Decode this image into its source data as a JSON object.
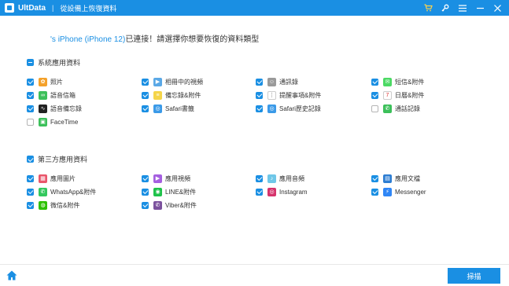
{
  "titlebar": {
    "app_name": "UltData",
    "separator": "|",
    "subtitle": "從設備上恢復資料",
    "icons": [
      "cart-icon",
      "key-icon",
      "menu-icon",
      "minimize-icon",
      "close-icon"
    ]
  },
  "heading": {
    "device": "'s iPhone (iPhone 12)",
    "text": "已連接！請選擇你想要恢復的資料類型"
  },
  "colors": {
    "accent": "#1a8fe3",
    "titlebar": "#1a8fe3"
  },
  "sections": [
    {
      "title": "系統應用資料",
      "state": "partial",
      "items": [
        {
          "label": "照片",
          "checked": true,
          "icon": "photos-icon",
          "color": "#f4a12a"
        },
        {
          "label": "相冊中的視頻",
          "checked": true,
          "icon": "album-video-icon",
          "color": "#5aa8e6"
        },
        {
          "label": "通訊錄",
          "checked": true,
          "icon": "contacts-icon",
          "color": "#9a9a9a"
        },
        {
          "label": "短信&附件",
          "checked": true,
          "icon": "messages-icon",
          "color": "#4cd964"
        },
        {
          "label": "語音信箱",
          "checked": true,
          "icon": "voicemail-icon",
          "color": "#3cc05a"
        },
        {
          "label": "備忘錄&附件",
          "checked": true,
          "icon": "notes-icon",
          "color": "#f5d54a"
        },
        {
          "label": "提醒事項&附件",
          "checked": true,
          "icon": "reminders-icon",
          "color": "#ffffff"
        },
        {
          "label": "日曆&附件",
          "checked": true,
          "icon": "calendar-icon",
          "color": "#ffffff"
        },
        {
          "label": "語音備忘錄",
          "checked": true,
          "icon": "voice-memo-icon",
          "color": "#222222"
        },
        {
          "label": "Safari書籤",
          "checked": true,
          "icon": "safari-icon",
          "color": "#3b9ae8"
        },
        {
          "label": "Safari歷史記錄",
          "checked": true,
          "icon": "safari-history-icon",
          "color": "#3b9ae8"
        },
        {
          "label": "通話記錄",
          "checked": false,
          "icon": "call-log-icon",
          "color": "#3cc05a"
        },
        {
          "label": "FaceTime",
          "checked": false,
          "icon": "facetime-icon",
          "color": "#3cc05a"
        }
      ]
    },
    {
      "title": "第三方應用資料",
      "state": "checked",
      "items": [
        {
          "label": "應用圖片",
          "checked": true,
          "icon": "app-photos-icon",
          "color": "#e9566b"
        },
        {
          "label": "應用視頻",
          "checked": true,
          "icon": "app-video-icon",
          "color": "#a55fe0"
        },
        {
          "label": "應用音頻",
          "checked": true,
          "icon": "app-audio-icon",
          "color": "#6fc7e8"
        },
        {
          "label": "應用文檔",
          "checked": true,
          "icon": "app-docs-icon",
          "color": "#2d7dd2"
        },
        {
          "label": "WhatsApp&附件",
          "checked": true,
          "icon": "whatsapp-icon",
          "color": "#33c85d"
        },
        {
          "label": "LINE&附件",
          "checked": true,
          "icon": "line-icon",
          "color": "#1fc24a"
        },
        {
          "label": "Instagram",
          "checked": true,
          "icon": "instagram-icon",
          "color": "#d6336c"
        },
        {
          "label": "Messenger",
          "checked": true,
          "icon": "messenger-icon",
          "color": "#2f86f6"
        },
        {
          "label": "微信&附件",
          "checked": true,
          "icon": "wechat-icon",
          "color": "#2dc100"
        },
        {
          "label": "Viber&附件",
          "checked": true,
          "icon": "viber-icon",
          "color": "#7b519d"
        }
      ]
    }
  ],
  "footer": {
    "scan_label": "掃描",
    "home_icon": "home-icon"
  }
}
